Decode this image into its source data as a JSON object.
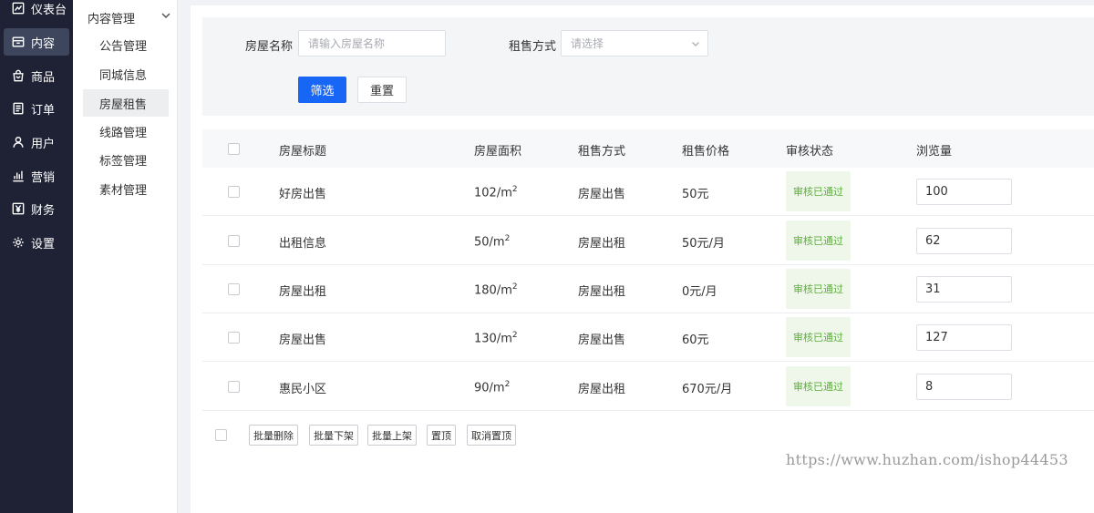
{
  "nav": {
    "items": [
      {
        "label": "仪表台",
        "icon": "chart-line-icon",
        "active": false
      },
      {
        "label": "内容",
        "icon": "inbox-icon",
        "active": true
      },
      {
        "label": "商品",
        "icon": "bag-icon",
        "active": false
      },
      {
        "label": "订单",
        "icon": "document-icon",
        "active": false
      },
      {
        "label": "用户",
        "icon": "user-icon",
        "active": false
      },
      {
        "label": "营销",
        "icon": "bar-chart-icon",
        "active": false
      },
      {
        "label": "财务",
        "icon": "yen-icon",
        "active": false
      },
      {
        "label": "设置",
        "icon": "gear-icon",
        "active": false
      }
    ]
  },
  "subnav": {
    "title": "内容管理",
    "items": [
      {
        "label": "公告管理",
        "active": false
      },
      {
        "label": "同城信息",
        "active": false
      },
      {
        "label": "房屋租售",
        "active": true
      },
      {
        "label": "线路管理",
        "active": false
      },
      {
        "label": "标签管理",
        "active": false
      },
      {
        "label": "素材管理",
        "active": false
      }
    ]
  },
  "filter": {
    "name_label": "房屋名称",
    "name_placeholder": "请输入房屋名称",
    "type_label": "租售方式",
    "type_placeholder": "请选择",
    "submit_label": "筛选",
    "reset_label": "重置"
  },
  "table": {
    "columns": [
      "房屋标题",
      "房屋面积",
      "租售方式",
      "租售价格",
      "审核状态",
      "浏览量"
    ],
    "area_unit": "/m",
    "area_exp": "2",
    "rows": [
      {
        "title": "好房出售",
        "area": "102",
        "type": "房屋出售",
        "price": "50元",
        "status": "审核已通过",
        "views": "100"
      },
      {
        "title": "出租信息",
        "area": "50",
        "type": "房屋出租",
        "price": "50元/月",
        "status": "审核已通过",
        "views": "62"
      },
      {
        "title": "房屋出租",
        "area": "180",
        "type": "房屋出租",
        "price": "0元/月",
        "status": "审核已通过",
        "views": "31"
      },
      {
        "title": "房屋出售",
        "area": "130",
        "type": "房屋出售",
        "price": "60元",
        "status": "审核已通过",
        "views": "127"
      },
      {
        "title": "惠民小区",
        "area": "90",
        "type": "房屋出租",
        "price": "670元/月",
        "status": "审核已通过",
        "views": "8"
      }
    ]
  },
  "bulk_actions": [
    "批量删除",
    "批量下架",
    "批量上架",
    "置顶",
    "取消置顶"
  ],
  "watermark": "https://www.huzhan.com/ishop44453",
  "colors": {
    "nav_bg": "#1f2235",
    "primary": "#1766f5",
    "status_bg": "#eef7ea",
    "status_text": "#5fae3e"
  }
}
